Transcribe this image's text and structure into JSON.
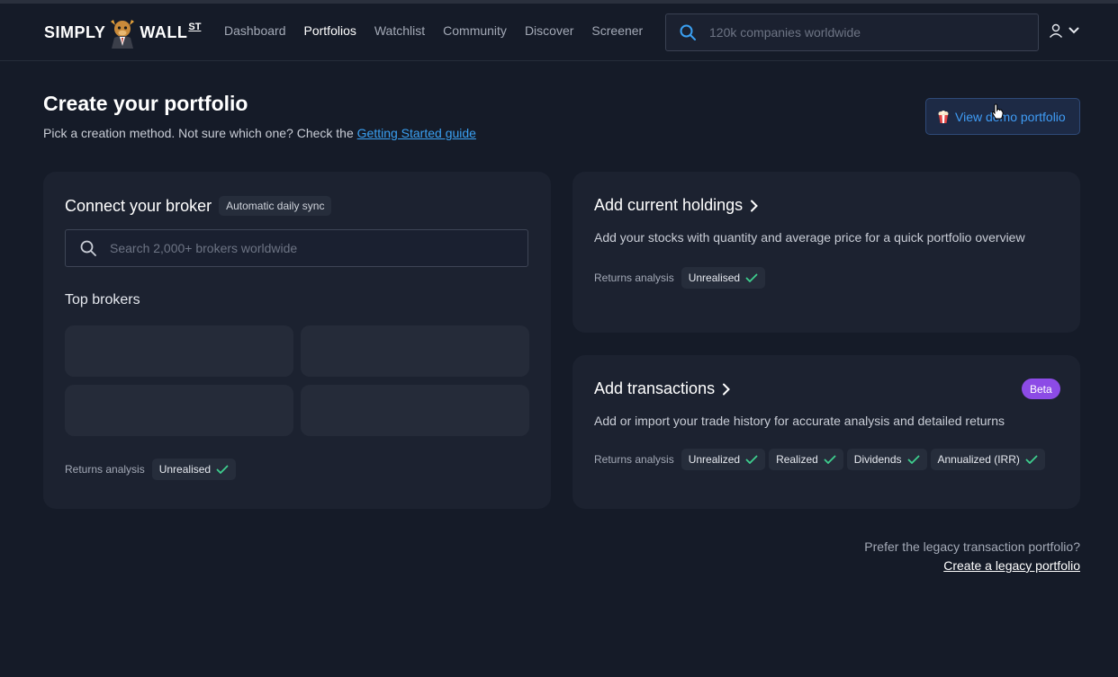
{
  "header": {
    "logo_text_left": "SIMPLY",
    "logo_text_right": "WALL",
    "logo_suffix": "ST",
    "nav": [
      {
        "label": "Dashboard"
      },
      {
        "label": "Portfolios"
      },
      {
        "label": "Watchlist"
      },
      {
        "label": "Community"
      },
      {
        "label": "Discover"
      },
      {
        "label": "Screener"
      }
    ],
    "active_nav": "Portfolios",
    "search_placeholder": "120k companies worldwide"
  },
  "page": {
    "title": "Create your portfolio",
    "subtitle_prefix": "Pick a creation method. Not sure which one? Check the ",
    "subtitle_link": "Getting Started guide",
    "demo_button": "View demo portfolio"
  },
  "broker_card": {
    "title": "Connect your broker",
    "sync_badge": "Automatic daily sync",
    "search_placeholder": "Search 2,000+ brokers worldwide",
    "top_brokers_label": "Top brokers",
    "returns_label": "Returns analysis",
    "returns_chips": [
      "Unrealised"
    ]
  },
  "holdings_card": {
    "title": "Add current holdings",
    "description": "Add your stocks with quantity and average price for a quick portfolio overview",
    "returns_label": "Returns analysis",
    "returns_chips": [
      "Unrealised"
    ]
  },
  "transactions_card": {
    "title": "Add transactions",
    "badge": "Beta",
    "description": "Add or import your trade history for accurate analysis and detailed returns",
    "returns_label": "Returns analysis",
    "returns_chips": [
      "Unrealized",
      "Realized",
      "Dividends",
      "Annualized (IRR)"
    ]
  },
  "legacy": {
    "question": "Prefer the legacy transaction portfolio?",
    "link": "Create a legacy portfolio"
  },
  "colors": {
    "background": "#151b28",
    "card": "#1c2230",
    "accent_blue": "#3aa0f2",
    "check_green": "#3ecf8e",
    "beta_purple": "#8c4be6"
  }
}
